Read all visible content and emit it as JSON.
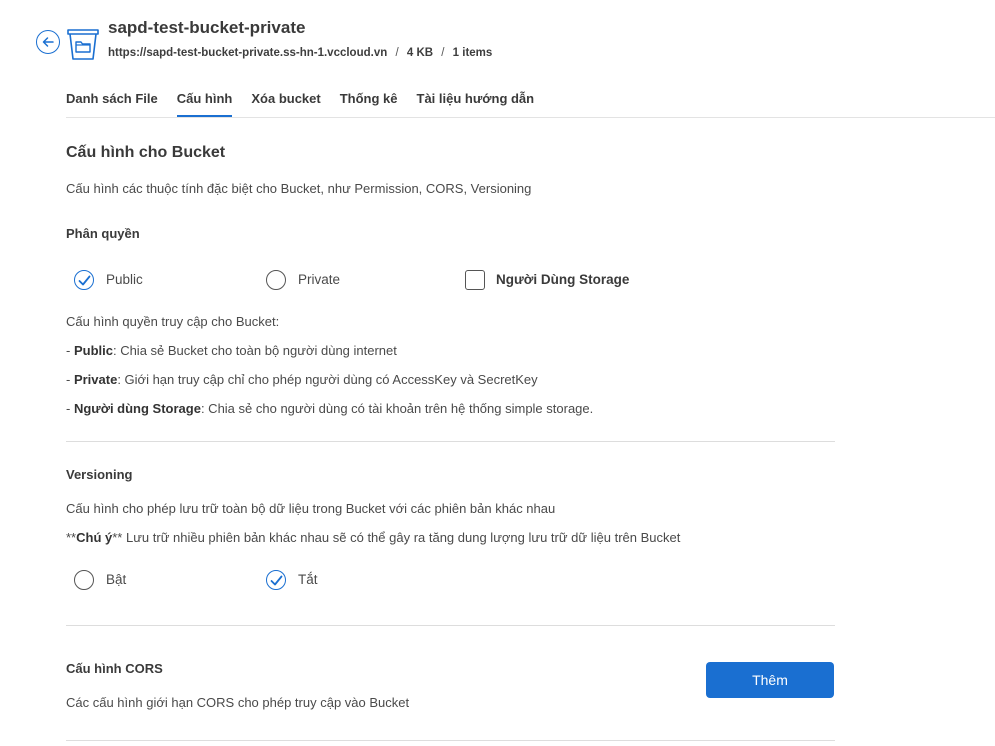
{
  "header": {
    "bucket_name": "sapd-test-bucket-private",
    "url": "https://sapd-test-bucket-private.ss-hn-1.vccloud.vn",
    "size": "4 KB",
    "items": "1 items",
    "separator": "/"
  },
  "tabs": [
    {
      "label": "Danh sách File"
    },
    {
      "label": "Cấu hình"
    },
    {
      "label": "Xóa bucket"
    },
    {
      "label": "Thống kê"
    },
    {
      "label": "Tài liệu hướng dẫn"
    }
  ],
  "active_tab": "Cấu hình",
  "page": {
    "title": "Cấu hình cho Bucket",
    "description": "Cấu hình các thuộc tính đặc biệt cho Bucket, như Permission, CORS, Versioning"
  },
  "permission": {
    "title": "Phân quyền",
    "options": {
      "public": "Public",
      "private": "Private",
      "storage_user": "Người Dùng Storage"
    },
    "selected": "Public",
    "intro": "Cấu hình quyền truy cập cho Bucket:",
    "notes": [
      {
        "prefix": "- ",
        "term": "Public",
        "text": ": Chia sẻ Bucket cho toàn bộ người dùng internet"
      },
      {
        "prefix": "- ",
        "term": "Private",
        "text": ": Giới hạn truy cập chỉ cho phép người dùng có AccessKey và SecretKey"
      },
      {
        "prefix": "- ",
        "term": "Người dùng Storage",
        "text": ": Chia sẻ cho người dùng có tài khoản trên hệ thống simple storage."
      }
    ]
  },
  "versioning": {
    "title": "Versioning",
    "description": "Cấu hình cho phép lưu trữ toàn bộ dữ liệu trong Bucket với các phiên bản khác nhau",
    "note_prefix": "**",
    "note_term": "Chú ý",
    "note_text": "** Lưu trữ nhiều phiên bản khác nhau sẽ có thể gây ra tăng dung lượng lưu trữ dữ liệu trên Bucket",
    "options": {
      "on": "Bật",
      "off": "Tắt"
    },
    "selected": "Tắt"
  },
  "cors": {
    "title": "Cấu hình CORS",
    "description": "Các cấu hình giới hạn CORS cho phép truy cập vào Bucket",
    "add_label": "Thêm"
  },
  "colors": {
    "accent": "#1a6fd1",
    "text": "#333333",
    "divider": "#dddddd"
  }
}
